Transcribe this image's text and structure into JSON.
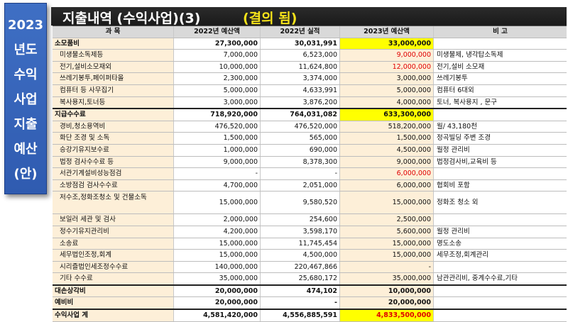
{
  "side_label": [
    "2023",
    "년도",
    "수익",
    "사업",
    "지출",
    "예산",
    "(안)"
  ],
  "title": "지출내역 (수익사업)(3)",
  "stamp": "(결의 됨)",
  "headers": [
    "과  목",
    "2022년 예산액",
    "2022년 실적",
    "2023년 예산액",
    "비      고"
  ],
  "rows": [
    {
      "item": "소모품비",
      "b2022": "27,300,000",
      "a2022": "30,031,991",
      "b2023": "33,000,000",
      "note": "",
      "kind": "cat",
      "highlight": true
    },
    {
      "item": "미생물소독제등",
      "b2022": "7,000,000",
      "a2022": "6,523,000",
      "b2023": "9,000,000",
      "note": "미생물제, 냉각탑소독제",
      "kind": "sub",
      "red": true
    },
    {
      "item": "전기,설비소모재외",
      "b2022": "10,000,000",
      "a2022": "11,624,800",
      "b2023": "12,000,000",
      "note": "전기,설비 소모재",
      "kind": "sub",
      "red": true
    },
    {
      "item": "쓰레기봉투,페이퍼타올",
      "b2022": "2,300,000",
      "a2022": "3,374,000",
      "b2023": "3,000,000",
      "note": "쓰레기봉투",
      "kind": "sub"
    },
    {
      "item": "컴퓨터 등 사무집기",
      "b2022": "5,000,000",
      "a2022": "4,633,991",
      "b2023": "5,000,000",
      "note": "컴퓨터 6대외",
      "kind": "sub"
    },
    {
      "item": "복사용지,토너등",
      "b2022": "3,000,000",
      "a2022": "3,876,200",
      "b2023": "4,000,000",
      "note": "토너, 복사용지 , 문구",
      "kind": "sub",
      "thick": true
    },
    {
      "item": "지급수수료",
      "b2022": "718,920,000",
      "a2022": "764,031,082",
      "b2023": "633,300,000",
      "note": "",
      "kind": "cat",
      "highlight": true
    },
    {
      "item": "경비,청소용역비",
      "b2022": "476,520,000",
      "a2022": "476,520,000",
      "b2023": "518,200,000",
      "note": "월/ 43,180천",
      "kind": "sub"
    },
    {
      "item": "화단 조경 및 소독",
      "b2022": "1,500,000",
      "a2022": "565,000",
      "b2023": "1,500,000",
      "note": "정곡빌딩 주변 조경",
      "kind": "sub"
    },
    {
      "item": "승강기유지보수료",
      "b2022": "1,000,000",
      "a2022": "690,000",
      "b2023": "4,500,000",
      "note": "월정 관리비",
      "kind": "sub"
    },
    {
      "item": "법정 검사수수료 등",
      "b2022": "9,000,000",
      "a2022": "8,378,300",
      "b2023": "9,000,000",
      "note": "법정검사비,교육비 등",
      "kind": "sub"
    },
    {
      "item": "서관기계설비성능점검",
      "b2022": "-",
      "a2022": "-",
      "b2023": "6,000,000",
      "note": "",
      "kind": "sub",
      "red": true
    },
    {
      "item": "소방점검 검사수수료",
      "b2022": "4,700,000",
      "a2022": "2,051,000",
      "b2023": "6,000,000",
      "note": "협회비 포함",
      "kind": "sub"
    },
    {
      "item": "저수조,정화조청소 및 건물소독",
      "b2022": "15,000,000",
      "a2022": "9,580,520",
      "b2023": "15,000,000",
      "note": "정화조 청소 외",
      "kind": "sub",
      "tall": true
    },
    {
      "item": "보일러 세관 및 검사",
      "b2022": "2,000,000",
      "a2022": "254,600",
      "b2023": "2,500,000",
      "note": "",
      "kind": "sub"
    },
    {
      "item": "정수기유지관리비",
      "b2022": "4,200,000",
      "a2022": "3,598,170",
      "b2023": "5,600,000",
      "note": "월정 관리비",
      "kind": "sub"
    },
    {
      "item": "소송료",
      "b2022": "15,000,000",
      "a2022": "11,745,454",
      "b2023": "15,000,000",
      "note": "명도소송",
      "kind": "sub"
    },
    {
      "item": "세무법인조정,회계",
      "b2022": "15,000,000",
      "a2022": "4,500,000",
      "b2023": "15,000,000",
      "note": "세무조정,회계관리",
      "kind": "sub"
    },
    {
      "item": "시리즐법인세조정수수료",
      "b2022": "140,000,000",
      "a2022": "220,467,866",
      "b2023": "-",
      "note": "",
      "kind": "sub"
    },
    {
      "item": "기타 수수료",
      "b2022": "35,000,000",
      "a2022": "25,680,172",
      "b2023": "35,000,000",
      "note": "남관관리비, 중계수수료,기타",
      "kind": "sub",
      "thick": true
    },
    {
      "item": "대손상각비",
      "b2022": "20,000,000",
      "a2022": "474,102",
      "b2023": "10,000,000",
      "note": "",
      "kind": "cat"
    },
    {
      "item": "예비비",
      "b2022": "20,000,000",
      "a2022": "-",
      "b2023": "20,000,000",
      "note": "",
      "kind": "cat",
      "thick": true
    },
    {
      "item": "수익사업    계",
      "b2022": "4,581,420,000",
      "a2022": "4,556,885,591",
      "b2023": "4,833,500,000",
      "note": "",
      "kind": "cat",
      "highlight": true,
      "red": true
    }
  ]
}
